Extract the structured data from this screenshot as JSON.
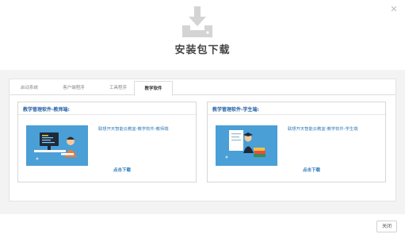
{
  "dialog": {
    "title": "安装包下载",
    "close_icon": "close-icon"
  },
  "tabs": [
    {
      "label": "启动系统",
      "active": false
    },
    {
      "label": "客户端程序",
      "active": false
    },
    {
      "label": "工具程序",
      "active": false
    },
    {
      "label": "教学软件",
      "active": true
    }
  ],
  "cards": [
    {
      "title": "教学管理软件-教师端:",
      "description": "联想开天智能云教室-教学软件-教师端",
      "download_label": "点击下载",
      "image_icon": "teacher-illustration"
    },
    {
      "title": "教学管理软件-学生端:",
      "description": "联想开天智能云教室-教学软件-学生端",
      "download_label": "点击下载",
      "image_icon": "student-illustration"
    }
  ],
  "footer": {
    "close_label": "关闭"
  },
  "colors": {
    "accent": "#2e7ab8",
    "card_image_bg": "#4a9fd6",
    "body_bg": "#f3f3f3"
  }
}
